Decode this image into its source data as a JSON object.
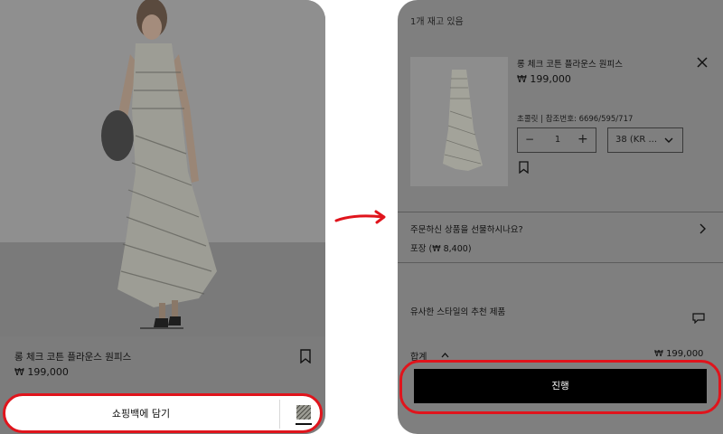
{
  "left_screen": {
    "product_name": "롱 체크 코튼 플라운스 원피스",
    "price": "₩ 199,000",
    "add_to_bag_label": "쇼핑백에 담기"
  },
  "right_screen": {
    "stock_text": "1개 재고 있음",
    "product_name": "롱 체크 코튼 플라운스 원피스",
    "price": "₩ 199,000",
    "color_ref": "초콜릿 | 참조번호: 6696/595/717",
    "quantity": "1",
    "size": "38 (KR ...",
    "gift_question": "주문하신 상품을 선물하시나요?",
    "gift_wrap": "포장 (₩ 8,400)",
    "recommendations": "유사한 스타일의 추천 제품",
    "total_label": "합계",
    "total_amount": "₩ 199,000",
    "proceed_label": "진행"
  },
  "colors": {
    "highlight": "#e0141c",
    "overlay": "#7f7f7f",
    "button": "#000000"
  },
  "icons": [
    "bookmark-icon",
    "close-icon",
    "minus-icon",
    "plus-icon",
    "chevron-down-icon",
    "chevron-right-icon",
    "chevron-up-icon",
    "chat-icon",
    "fabric-swatch",
    "arrow-icon"
  ]
}
